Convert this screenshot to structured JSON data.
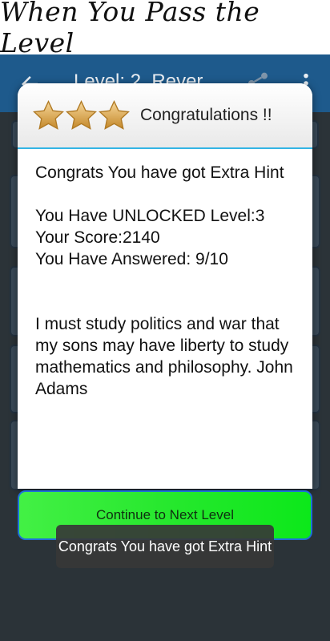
{
  "banner": {
    "text": "When You Pass the Level"
  },
  "appbar": {
    "title": "Level: 2, Rever..."
  },
  "dialog": {
    "title": "Congratulations !!",
    "stars": 3,
    "line1": "Congrats You have got Extra Hint",
    "unlocked": "You Have UNLOCKED Level:3",
    "score": "Your Score:2140",
    "answered": "You Have Answered: 9/10",
    "quote": "I must study politics and war that my sons may have liberty to study mathematics and philosophy. John Adams"
  },
  "cta": {
    "label": "Continue to Next Level"
  },
  "toast": {
    "text": "Congrats You have got Extra Hint"
  },
  "colors": {
    "appbar": "#1e5a8c",
    "accent": "#33b5e5",
    "cta": "#27e82e"
  }
}
